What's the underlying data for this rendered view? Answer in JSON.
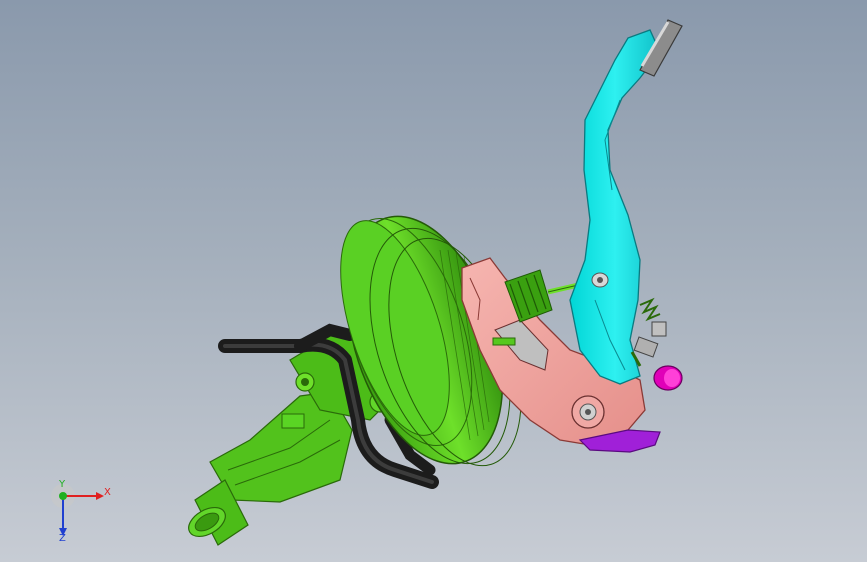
{
  "view": {
    "background_top": "#8a99ac",
    "background_bottom": "#c7ccd4"
  },
  "model": {
    "parts": [
      {
        "name": "brake-pedal-arm",
        "color": "#1fe5e5"
      },
      {
        "name": "pedal-pad",
        "color": "#8c8c8c"
      },
      {
        "name": "brake-booster",
        "color": "#4fc81a"
      },
      {
        "name": "master-cylinder",
        "color": "#4fc81a"
      },
      {
        "name": "pedal-bracket",
        "color": "#f3a3a0"
      },
      {
        "name": "pedal-stop",
        "color": "#a020d8"
      },
      {
        "name": "brake-switch",
        "color": "#e000b8"
      },
      {
        "name": "vacuum-hose",
        "color": "#1c1c1c"
      }
    ]
  },
  "triad": {
    "x_label": "X",
    "y_label": "Y",
    "z_label": "Z",
    "x_color": "#e02020",
    "y_color": "#20b020",
    "z_color": "#2040d0"
  }
}
